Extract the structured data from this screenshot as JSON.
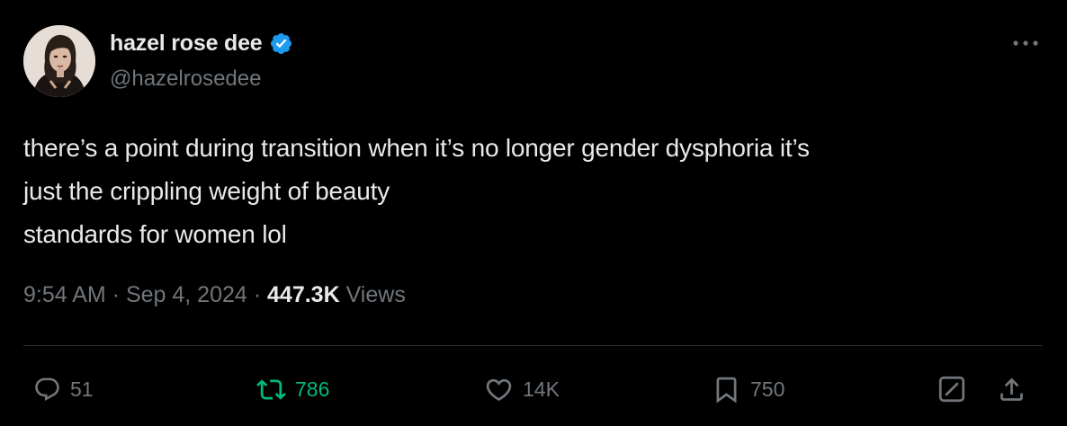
{
  "author": {
    "display_name": "hazel rose dee",
    "handle": "@hazelrosedee",
    "verified": true
  },
  "tweet": {
    "text": "there’s a point during transition when it’s no longer gender dysphoria it’s\njust the crippling weight of beauty\nstandards for women lol",
    "time": "9:54 AM",
    "separator": " · ",
    "date": "Sep 4, 2024",
    "views_count": "447.3K",
    "views_label": " Views"
  },
  "actions": {
    "replies": "51",
    "retweets": "786",
    "likes": "14K",
    "bookmarks": "750"
  },
  "colors": {
    "background": "#000000",
    "text_primary": "#e7e9ea",
    "text_secondary": "#71767b",
    "verified_blue": "#1d9bf0",
    "retweet_green": "#00ba7c",
    "divider": "#2f3336"
  },
  "icons": {
    "verified": "verified-badge-icon",
    "more": "more-options-icon",
    "reply": "reply-icon",
    "retweet": "retweet-icon",
    "like": "heart-icon",
    "bookmark": "bookmark-icon",
    "grok": "grok-icon",
    "share": "share-icon"
  }
}
